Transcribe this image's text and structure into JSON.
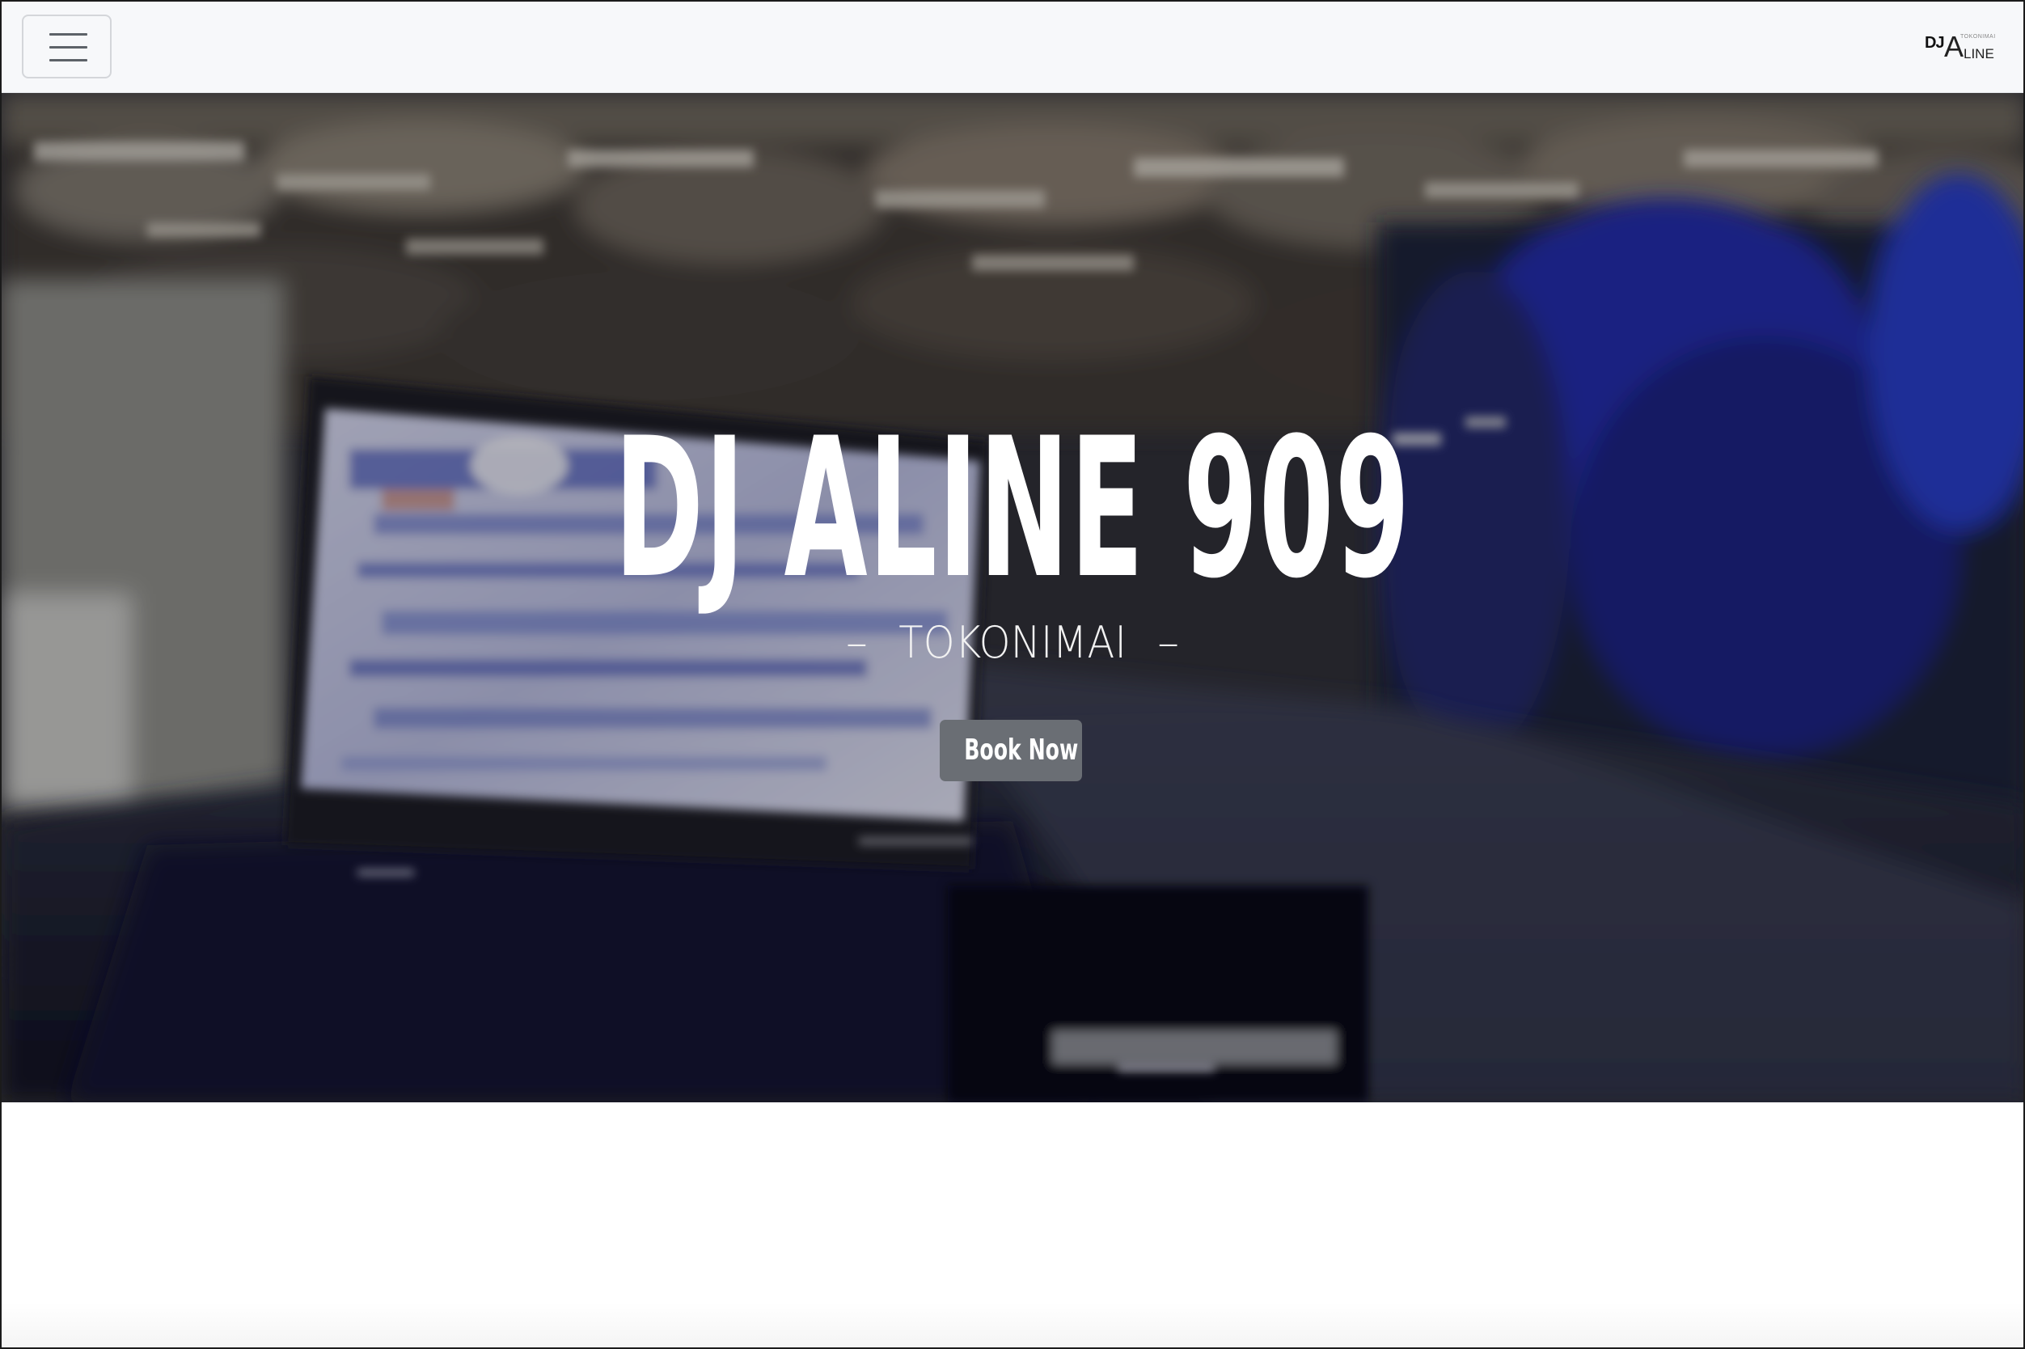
{
  "navbar": {
    "toggler_icon": "hamburger-menu-icon",
    "logo": {
      "dj": "DJ",
      "a": "A",
      "top_text": "TOKONIMAI",
      "line": "LINE"
    }
  },
  "hero": {
    "title": "DJ ALINE 909",
    "subtitle": "TOKONIMAI",
    "subtitle_dash": "–",
    "button_label": "Book Now",
    "background": "blurred-dj-booth-laptop-crowd-photo"
  },
  "colors": {
    "navbar_bg": "#f7f8fa",
    "button_bg": "#6a6e74",
    "title_text": "#ffffff"
  }
}
